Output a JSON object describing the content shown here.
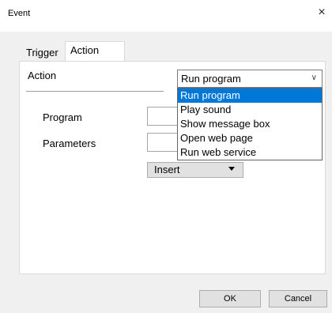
{
  "window": {
    "title": "Event",
    "close_glyph": "×"
  },
  "tabs": [
    {
      "label": "Trigger",
      "active": false
    },
    {
      "label": "Action",
      "active": true
    }
  ],
  "action_section": {
    "label": "Action",
    "selected_value": "Run program",
    "dropdown_options": [
      "Run program",
      "Play sound",
      "Show message box",
      "Open web page",
      "Run web service"
    ],
    "highlighted_option": "Run program"
  },
  "fields": {
    "program_label": "Program",
    "program_value": "",
    "parameters_label": "Parameters",
    "parameters_value": ""
  },
  "insert_button": {
    "label": "Insert"
  },
  "footer": {
    "ok_label": "OK",
    "cancel_label": "Cancel"
  },
  "colors": {
    "selection_highlight": "#0078d7",
    "window_background": "#f0f0f0",
    "button_face": "#e1e1e1"
  }
}
